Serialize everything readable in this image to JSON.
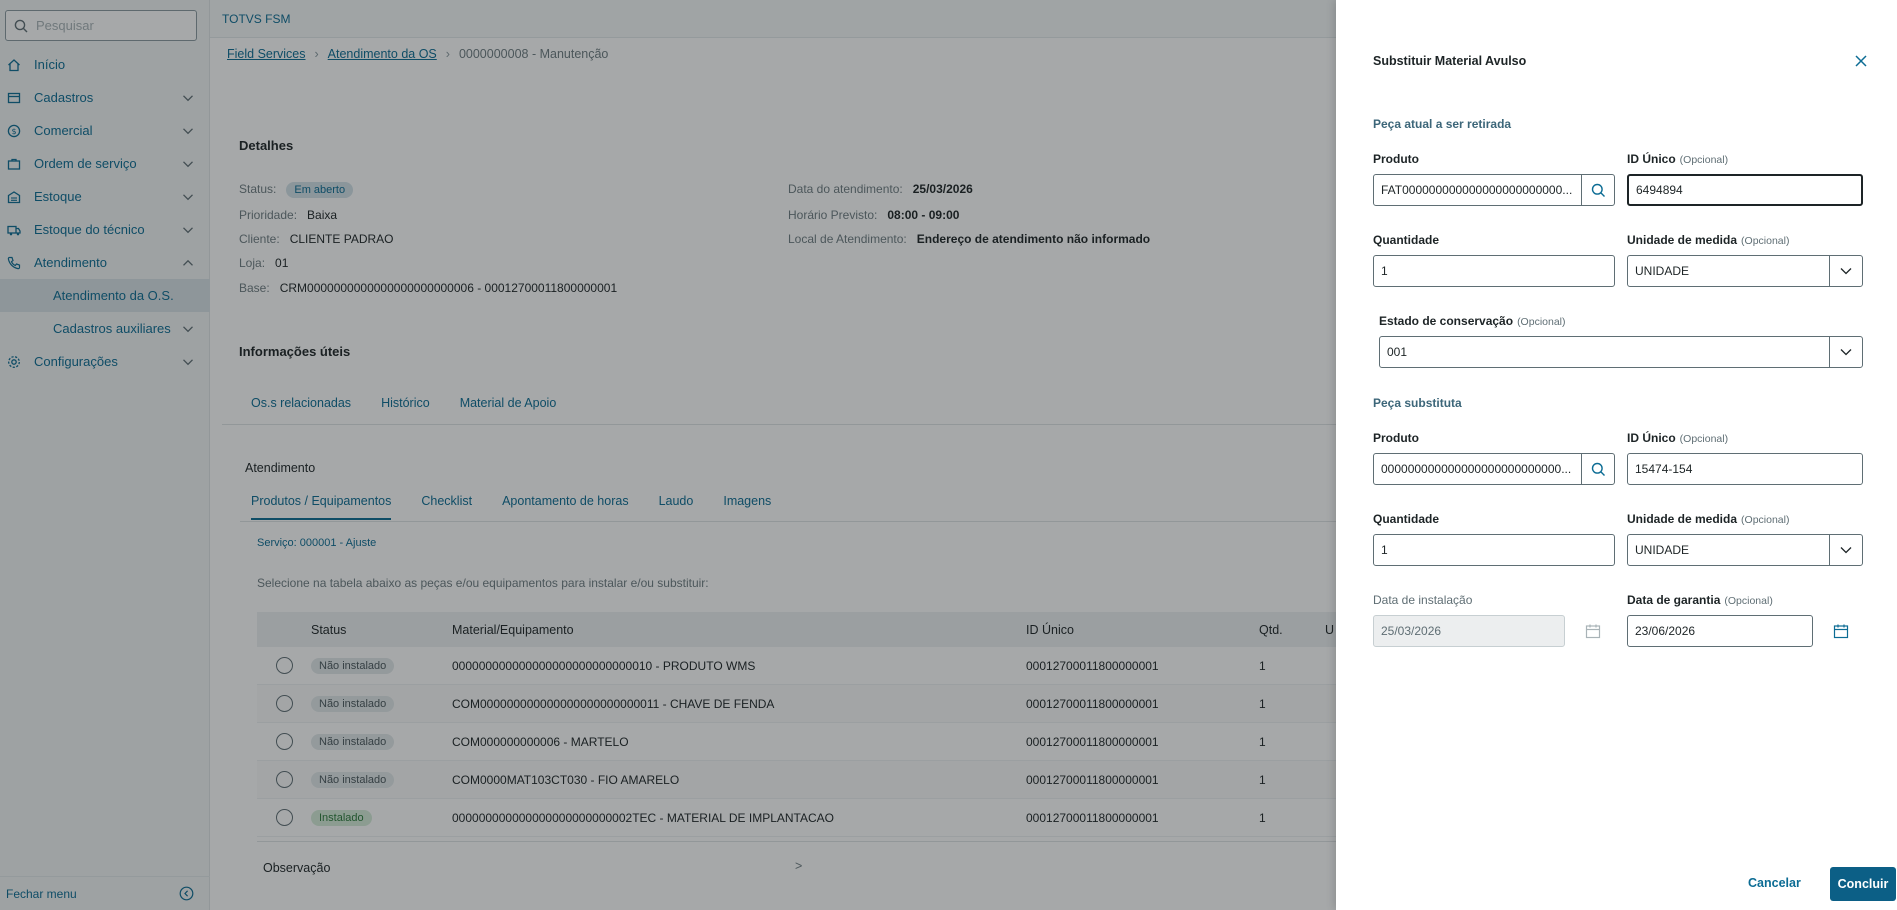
{
  "sidebar": {
    "search_placeholder": "Pesquisar",
    "items": [
      {
        "label": "Início"
      },
      {
        "label": "Cadastros"
      },
      {
        "label": "Comercial"
      },
      {
        "label": "Ordem de serviço"
      },
      {
        "label": "Estoque"
      },
      {
        "label": "Estoque do técnico"
      },
      {
        "label": "Atendimento"
      },
      {
        "label": "Atendimento da O.S."
      },
      {
        "label": "Cadastros auxiliares"
      },
      {
        "label": "Configurações"
      }
    ],
    "footer_label": "Fechar menu"
  },
  "app": {
    "title": "TOTVS FSM"
  },
  "breadcrumb": {
    "item1": "Field Services",
    "item2": "Atendimento da OS",
    "current": "0000000008 - Manutenção"
  },
  "details": {
    "title": "Detalhes",
    "status_label": "Status:",
    "status_value": "Em aberto",
    "priority_label": "Prioridade:",
    "priority_value": "Baixa",
    "client_label": "Cliente:",
    "client_value": "CLIENTE PADRAO",
    "store_label": "Loja:",
    "store_value": "01",
    "base_label": "Base:",
    "base_value": "CRM0000000000000000000000006 - 00012700011800000001",
    "date_label": "Data do atendimento:",
    "date_value": "25/03/2026",
    "time_label": "Horário Previsto:",
    "time_value": "08:00 - 09:00",
    "place_label": "Local de Atendimento:",
    "place_value": "Endereço de atendimento não informado"
  },
  "info": {
    "title": "Informações úteis",
    "tabs": [
      "Os.s relacionadas",
      "Histórico",
      "Material de Apoio"
    ]
  },
  "service": {
    "title": "Atendimento",
    "tabs": [
      "Produtos / Equipamentos",
      "Checklist",
      "Apontamento de horas",
      "Laudo",
      "Imagens"
    ],
    "service_note": "Serviço: 000001 - Ajuste",
    "hint": "Selecione na tabela abaixo as peças e/ou equipamentos para instalar e/ou substituir:",
    "columns": {
      "status": "Status",
      "material": "Material/Equipamento",
      "id": "ID Único",
      "qty": "Qtd.",
      "extra": "U"
    },
    "rows": [
      {
        "status": "Não instalado",
        "material": "000000000000000000000000000010 - PRODUTO WMS",
        "id": "00012700011800000001",
        "qty": "1"
      },
      {
        "status": "Não instalado",
        "material": "COM000000000000000000000000011 - CHAVE DE FENDA",
        "id": "00012700011800000001",
        "qty": "1"
      },
      {
        "status": "Não instalado",
        "material": "COM000000000006 - MARTELO",
        "id": "00012700011800000001",
        "qty": "1"
      },
      {
        "status": "Não instalado",
        "material": "COM0000MAT103CT030 - FIO AMARELO",
        "id": "00012700011800000001",
        "qty": "1"
      },
      {
        "status": "Instalado",
        "material": "000000000000000000000000002TEC - MATERIAL DE IMPLANTACAO",
        "id": "00012700011800000001",
        "qty": "1"
      }
    ],
    "obs_label": "Observação",
    "obs_marker": ">"
  },
  "drawer": {
    "title": "Substituir Material Avulso",
    "section_current": "Peça atual a ser retirada",
    "section_new": "Peça substituta",
    "optional": "(Opcional)",
    "current": {
      "product_label": "Produto",
      "product_value": "FAT000000000000000000000000...",
      "id_label": "ID Único",
      "id_value": "6494894",
      "qty_label": "Quantidade",
      "qty_value": "1",
      "unit_label": "Unidade de medida",
      "unit_value": "UNIDADE",
      "cond_label": "Estado de conservação",
      "cond_value": "001"
    },
    "new": {
      "product_label": "Produto",
      "product_value": "000000000000000000000000000...",
      "id_label": "ID Único",
      "id_value": "15474-154",
      "qty_label": "Quantidade",
      "qty_value": "1",
      "unit_label": "Unidade de medida",
      "unit_value": "UNIDADE",
      "install_label": "Data de instalação",
      "install_value": "25/03/2026",
      "warranty_label": "Data de garantia",
      "warranty_value": "23/06/2026"
    },
    "cancel_label": "Cancelar",
    "confirm_label": "Concluir"
  },
  "colors": {
    "accent": "#0c6c94",
    "primary_button": "#0c5f86",
    "overlay": "#141a1c"
  }
}
